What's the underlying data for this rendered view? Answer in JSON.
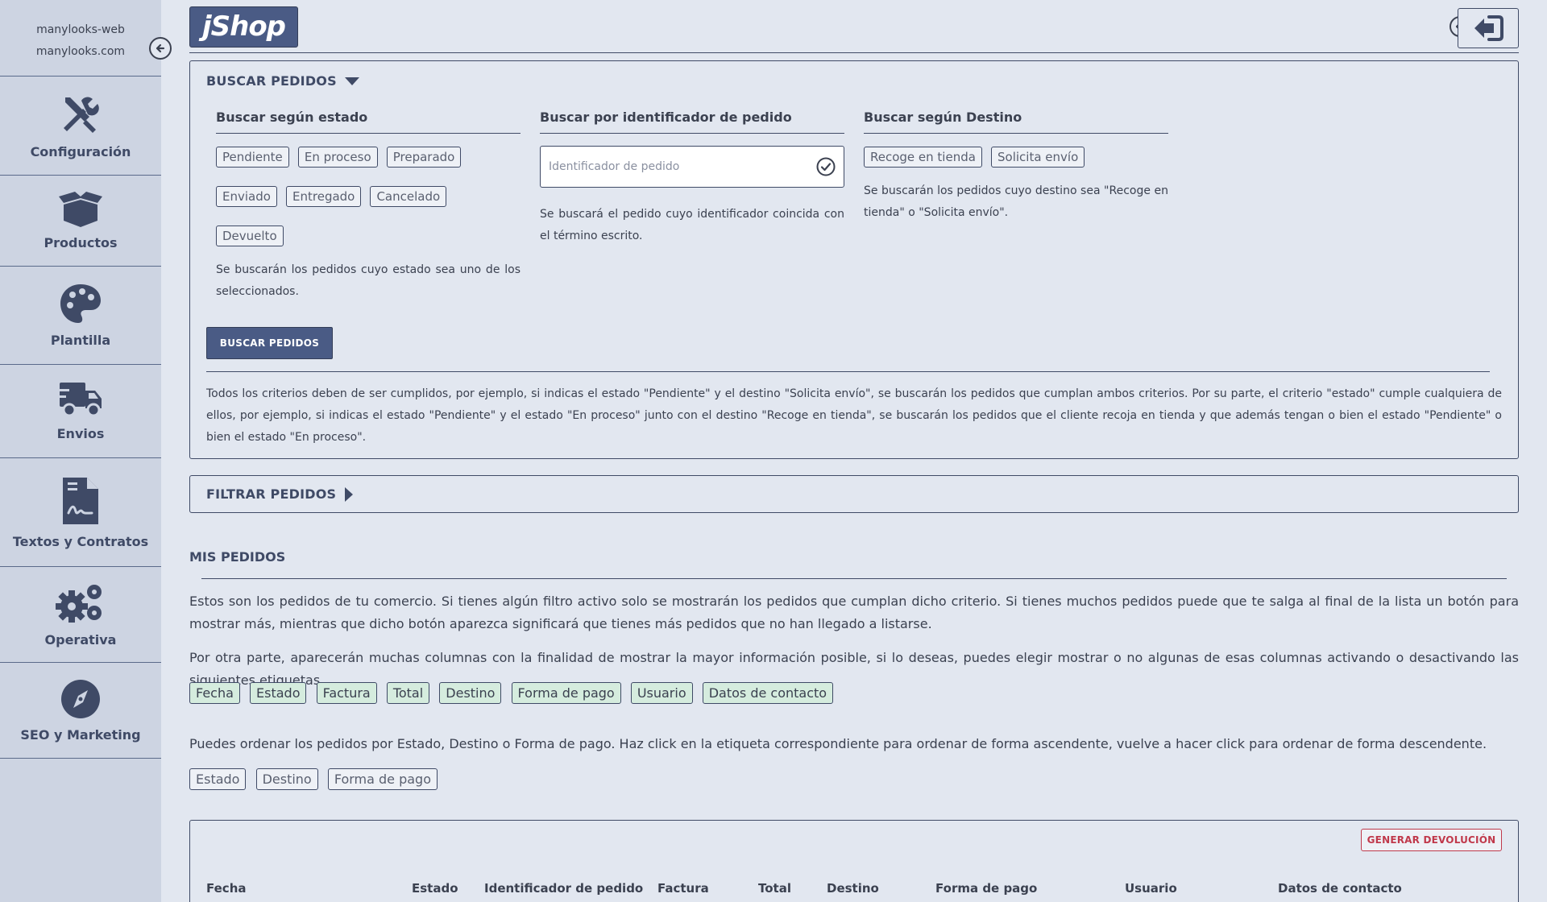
{
  "sidebar": {
    "account_name": "manylooks-web",
    "account_domain": "manylooks.com",
    "items": [
      {
        "label": "Configuración",
        "icon": "tools-icon"
      },
      {
        "label": "Productos",
        "icon": "open-box-icon"
      },
      {
        "label": "Plantilla",
        "icon": "palette-icon"
      },
      {
        "label": "Envios",
        "icon": "truck-icon"
      },
      {
        "label": "Textos y Contratos",
        "icon": "contract-icon"
      },
      {
        "label": "Operativa",
        "icon": "gears-icon"
      },
      {
        "label": "SEO y Marketing",
        "icon": "compass-icon"
      }
    ]
  },
  "header": {
    "logo": "jShop"
  },
  "search": {
    "title": "BUSCAR PEDIDOS",
    "by_status": {
      "heading": "Buscar según estado",
      "tags": [
        "Pendiente",
        "En proceso",
        "Preparado",
        "Enviado",
        "Entregado",
        "Cancelado",
        "Devuelto"
      ],
      "description": "Se buscarán los pedidos cuyo estado sea uno de los seleccionados."
    },
    "by_id": {
      "heading": "Buscar por identificador de pedido",
      "placeholder": "Identificador de pedido",
      "description": "Se buscará el pedido cuyo identificador coincida con el término escrito."
    },
    "by_destination": {
      "heading": "Buscar según Destino",
      "tags": [
        "Recoge en tienda",
        "Solicita envío"
      ],
      "description": "Se buscarán los pedidos cuyo destino sea \"Recoge en tienda\" o \"Solicita envío\"."
    },
    "button": "BUSCAR PEDIDOS",
    "note": "Todos los criterios deben de ser cumplidos, por ejemplo, si indicas el estado \"Pendiente\" y el destino \"Solicita envío\", se buscarán los pedidos que cumplan ambos criterios. Por su parte, el criterio \"estado\" cumple cualquiera de ellos, por ejemplo, si indicas el estado \"Pendiente\" y el estado \"En proceso\" junto con el destino \"Recoge en tienda\", se buscarán los pedidos que el cliente recoja en tienda y que además tengan o bien el estado \"Pendiente\" o bien el estado \"En proceso\"."
  },
  "filter": {
    "title": "FILTRAR PEDIDOS"
  },
  "orders": {
    "title": "MIS PEDIDOS",
    "intro": "Estos son los pedidos de tu comercio. Si tienes algún filtro activo solo se mostrarán los pedidos que cumplan dicho criterio. Si tienes muchos pedidos puede que te salga al final de la lista un botón para mostrar más, mientras que dicho botón aparezca significará que tienes más pedidos que no han llegado a listarse.",
    "columns_text": "Por otra parte, aparecerán muchas columnas con la finalidad de mostrar la mayor información posible, si lo deseas, puedes elegir mostrar o no algunas de esas columnas activando o desactivando las siguientes etiquetas.",
    "column_tags": [
      "Fecha",
      "Estado",
      "Factura",
      "Total",
      "Destino",
      "Forma de pago",
      "Usuario",
      "Datos de contacto"
    ],
    "sort_text": "Puedes ordenar los pedidos por Estado, Destino o Forma de pago. Haz click en la etiqueta correspondiente para ordenar de forma ascendente, vuelve a hacer click para ordenar de forma descendente.",
    "sort_tags": [
      "Estado",
      "Destino",
      "Forma de pago"
    ],
    "return_button": "GENERAR DEVOLUCIÓN",
    "table_headers": [
      "Fecha",
      "Estado",
      "Identificador de pedido",
      "Factura",
      "Total",
      "Destino",
      "Forma de pago",
      "Usuario",
      "Datos de contacto"
    ]
  },
  "colors": {
    "primary": "#4a5b85",
    "sidebar": "#cdd4e2",
    "background": "#e2e7f0",
    "active_tag": "#d5ecde",
    "danger": "#c0394b"
  }
}
